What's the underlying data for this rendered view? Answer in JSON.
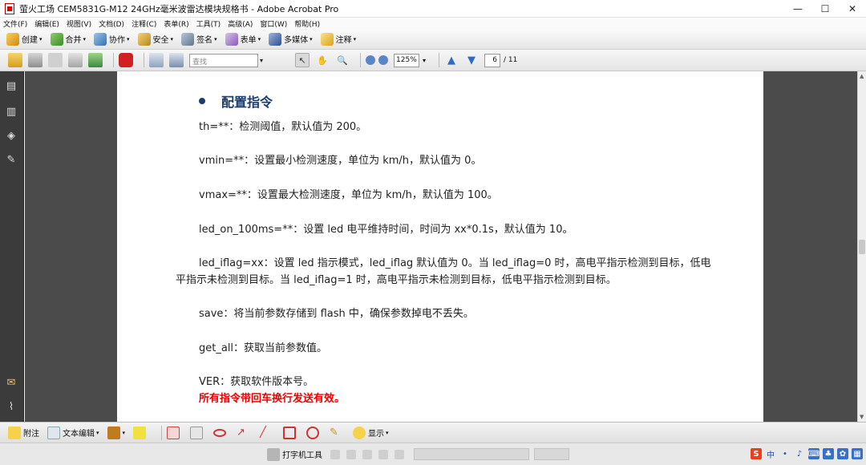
{
  "window": {
    "title": "萤火工场 CEM5831G-M12 24GHz毫米波雷达模块规格书 - Adobe Acrobat Pro",
    "minimize": "—",
    "maximize": "☐",
    "close": "✕"
  },
  "menu": [
    "文件(F)",
    "编辑(E)",
    "视图(V)",
    "文档(D)",
    "注释(C)",
    "表单(R)",
    "工具(T)",
    "高级(A)",
    "窗口(W)",
    "帮助(H)"
  ],
  "toolbar1": {
    "create": "创建",
    "combine": "合并",
    "collaborate": "协作",
    "secure": "安全",
    "sign": "签名",
    "forms": "表单",
    "multimedia": "多媒体",
    "comment": "注释"
  },
  "toolbar2": {
    "search_placeholder": "查找",
    "zoom": "125%",
    "page_current": "6",
    "page_total": "/ 11"
  },
  "document": {
    "heading": "配置指令",
    "lines": [
      "th=**：检测阈值，默认值为 200。",
      "vmin=**：设置最小检测速度，单位为 km/h，默认值为 0。",
      "vmax=**：设置最大检测速度，单位为 km/h，默认值为 100。",
      "led_on_100ms=**：设置 led 电平维持时间，时间为 xx*0.1s，默认值为 10。",
      "led_iflag=xx：设置 led 指示模式，led_iflag 默认值为 0。当 led_iflag=0 时，高电平指示检测到目标，低电",
      "平指示未检测到目标。当 led_iflag=1 时，高电平指示未检测到目标，低电平指示检测到目标。",
      "save：将当前参数存储到 flash 中，确保参数掉电不丢失。",
      "get_all：获取当前参数值。",
      "VER：获取软件版本号。"
    ],
    "note": "所有指令带回车换行发送有效。"
  },
  "bottom": {
    "attach": "附注",
    "text_edit": "文本编辑",
    "show": "显示",
    "typewriter": "打字机工具"
  },
  "tray": [
    "S",
    "中",
    "•",
    "♪",
    "⌨",
    "♣",
    "✿",
    "▦"
  ]
}
